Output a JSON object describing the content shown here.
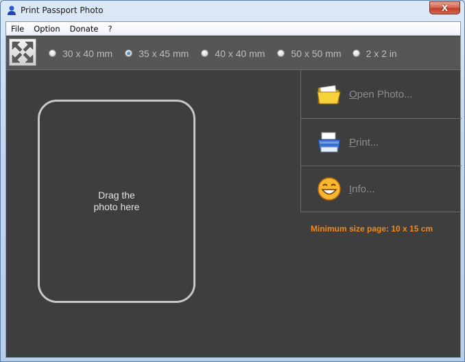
{
  "window": {
    "title": "Print Passport Photo",
    "close_label": "X"
  },
  "menu": [
    "File",
    "Option",
    "Donate",
    "?"
  ],
  "sizes": [
    {
      "label": "30 x 40 mm",
      "checked": false
    },
    {
      "label": "35 x 45 mm",
      "checked": true
    },
    {
      "label": "40 x 40 mm",
      "checked": false
    },
    {
      "label": "50 x 50 mm",
      "checked": false
    },
    {
      "label": "2 x 2 in",
      "checked": false
    }
  ],
  "photo": {
    "hint": "Drag the\nphoto here"
  },
  "actions": [
    {
      "first": "O",
      "rest": "pen Photo...",
      "icon": "folder-icon"
    },
    {
      "first": "P",
      "rest": "rint...",
      "icon": "printer-icon"
    },
    {
      "first": "I",
      "rest": "nfo...",
      "icon": "smiley-icon"
    }
  ],
  "notice": "Minimum size page: 10 x 15 cm",
  "colors": {
    "background": "#3e3e3e",
    "notice": "#f08a1c",
    "menubar": "#ffffff"
  }
}
